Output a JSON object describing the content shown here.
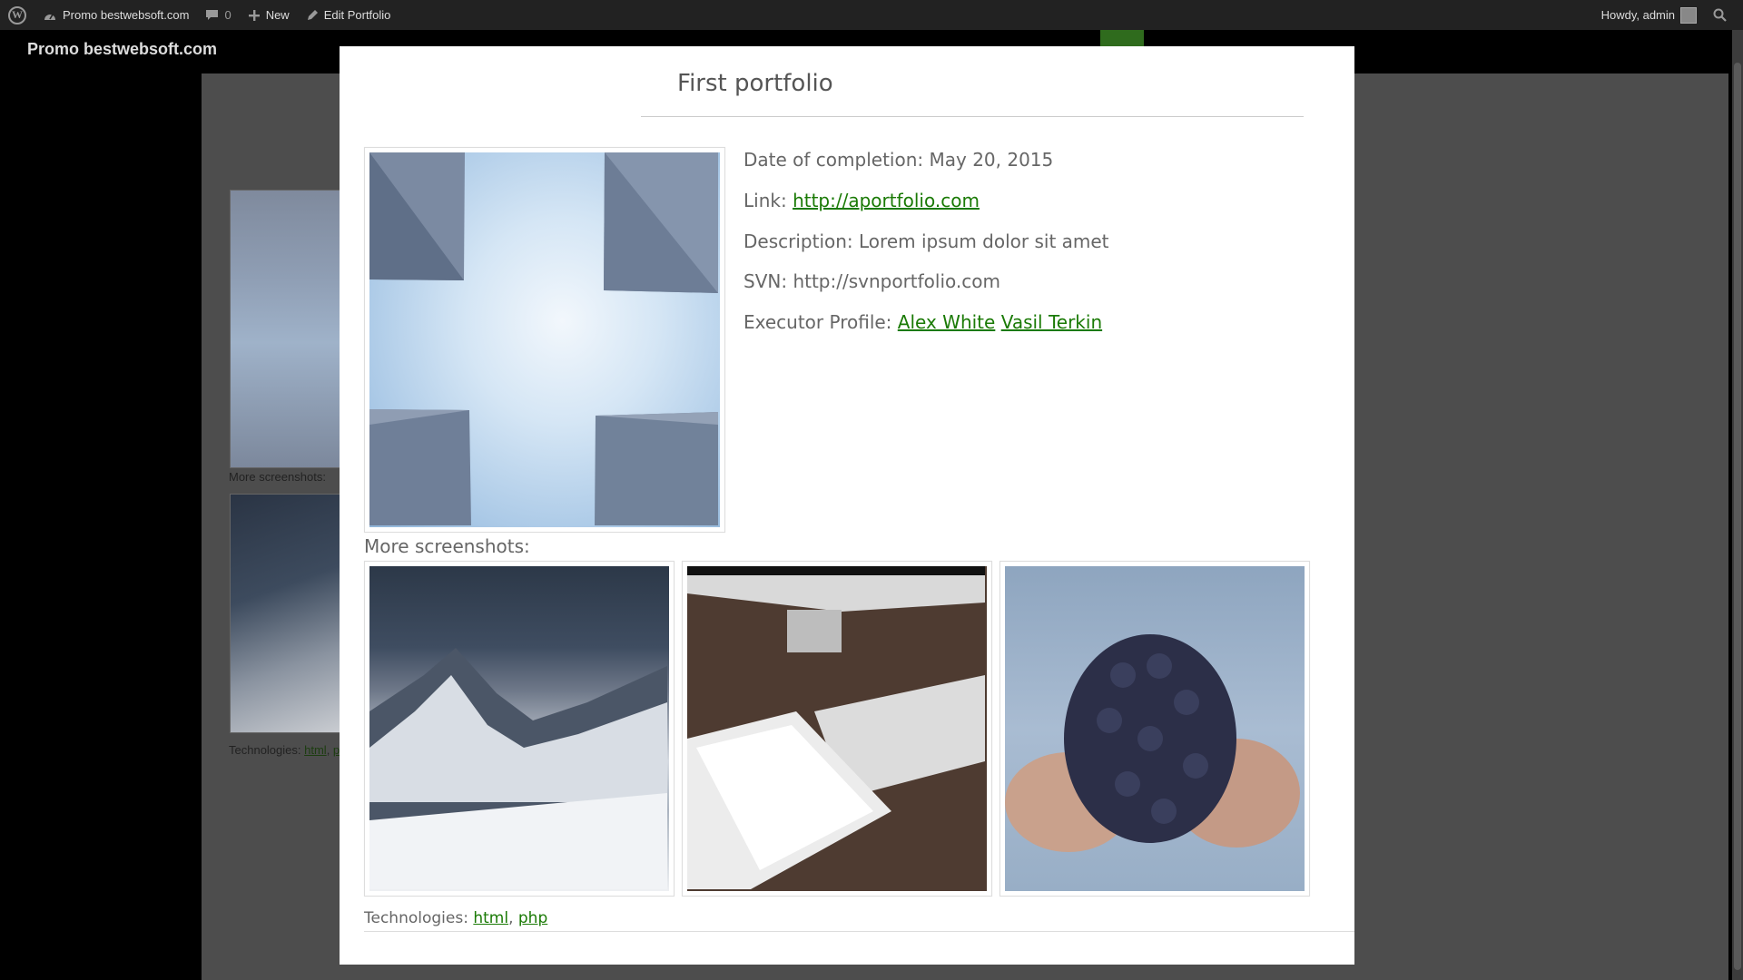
{
  "adminbar": {
    "site_name": "Promo bestwebsoft.com",
    "comments_count": "0",
    "new_label": "New",
    "edit_label": "Edit Portfolio",
    "howdy": "Howdy, admin"
  },
  "site": {
    "title": "Promo bestwebsoft.com",
    "more_screenshots": "More screenshots:",
    "technologies_label": "Technologies:",
    "tech_html": "html",
    "tech_php_partial": "p"
  },
  "modal": {
    "title": "First portfolio",
    "date_label": "Date of completion:",
    "date_value": "May 20, 2015",
    "link_label": "Link:",
    "link_value": "http://aportfolio.com",
    "description_label": "Description:",
    "description_value": "Lorem ipsum dolor sit amet",
    "svn_label": "SVN:",
    "svn_value": "http://svnportfolio.com",
    "executor_label": "Executor Profile:",
    "executors": [
      "Alex White",
      "Vasil Terkin"
    ],
    "more_screenshots": "More screenshots:",
    "technologies_label": "Technologies:",
    "technologies": [
      "html",
      "php"
    ],
    "technologies_sep": ","
  },
  "colors": {
    "link": "#1a7a05",
    "adminbar": "#222222",
    "overlay": "#000000"
  },
  "icons": {
    "wp": "wordpress-logo-icon",
    "site": "dashboard-icon",
    "comments": "comment-bubble-icon",
    "new": "plus-icon",
    "edit": "pencil-icon",
    "search": "search-icon"
  }
}
